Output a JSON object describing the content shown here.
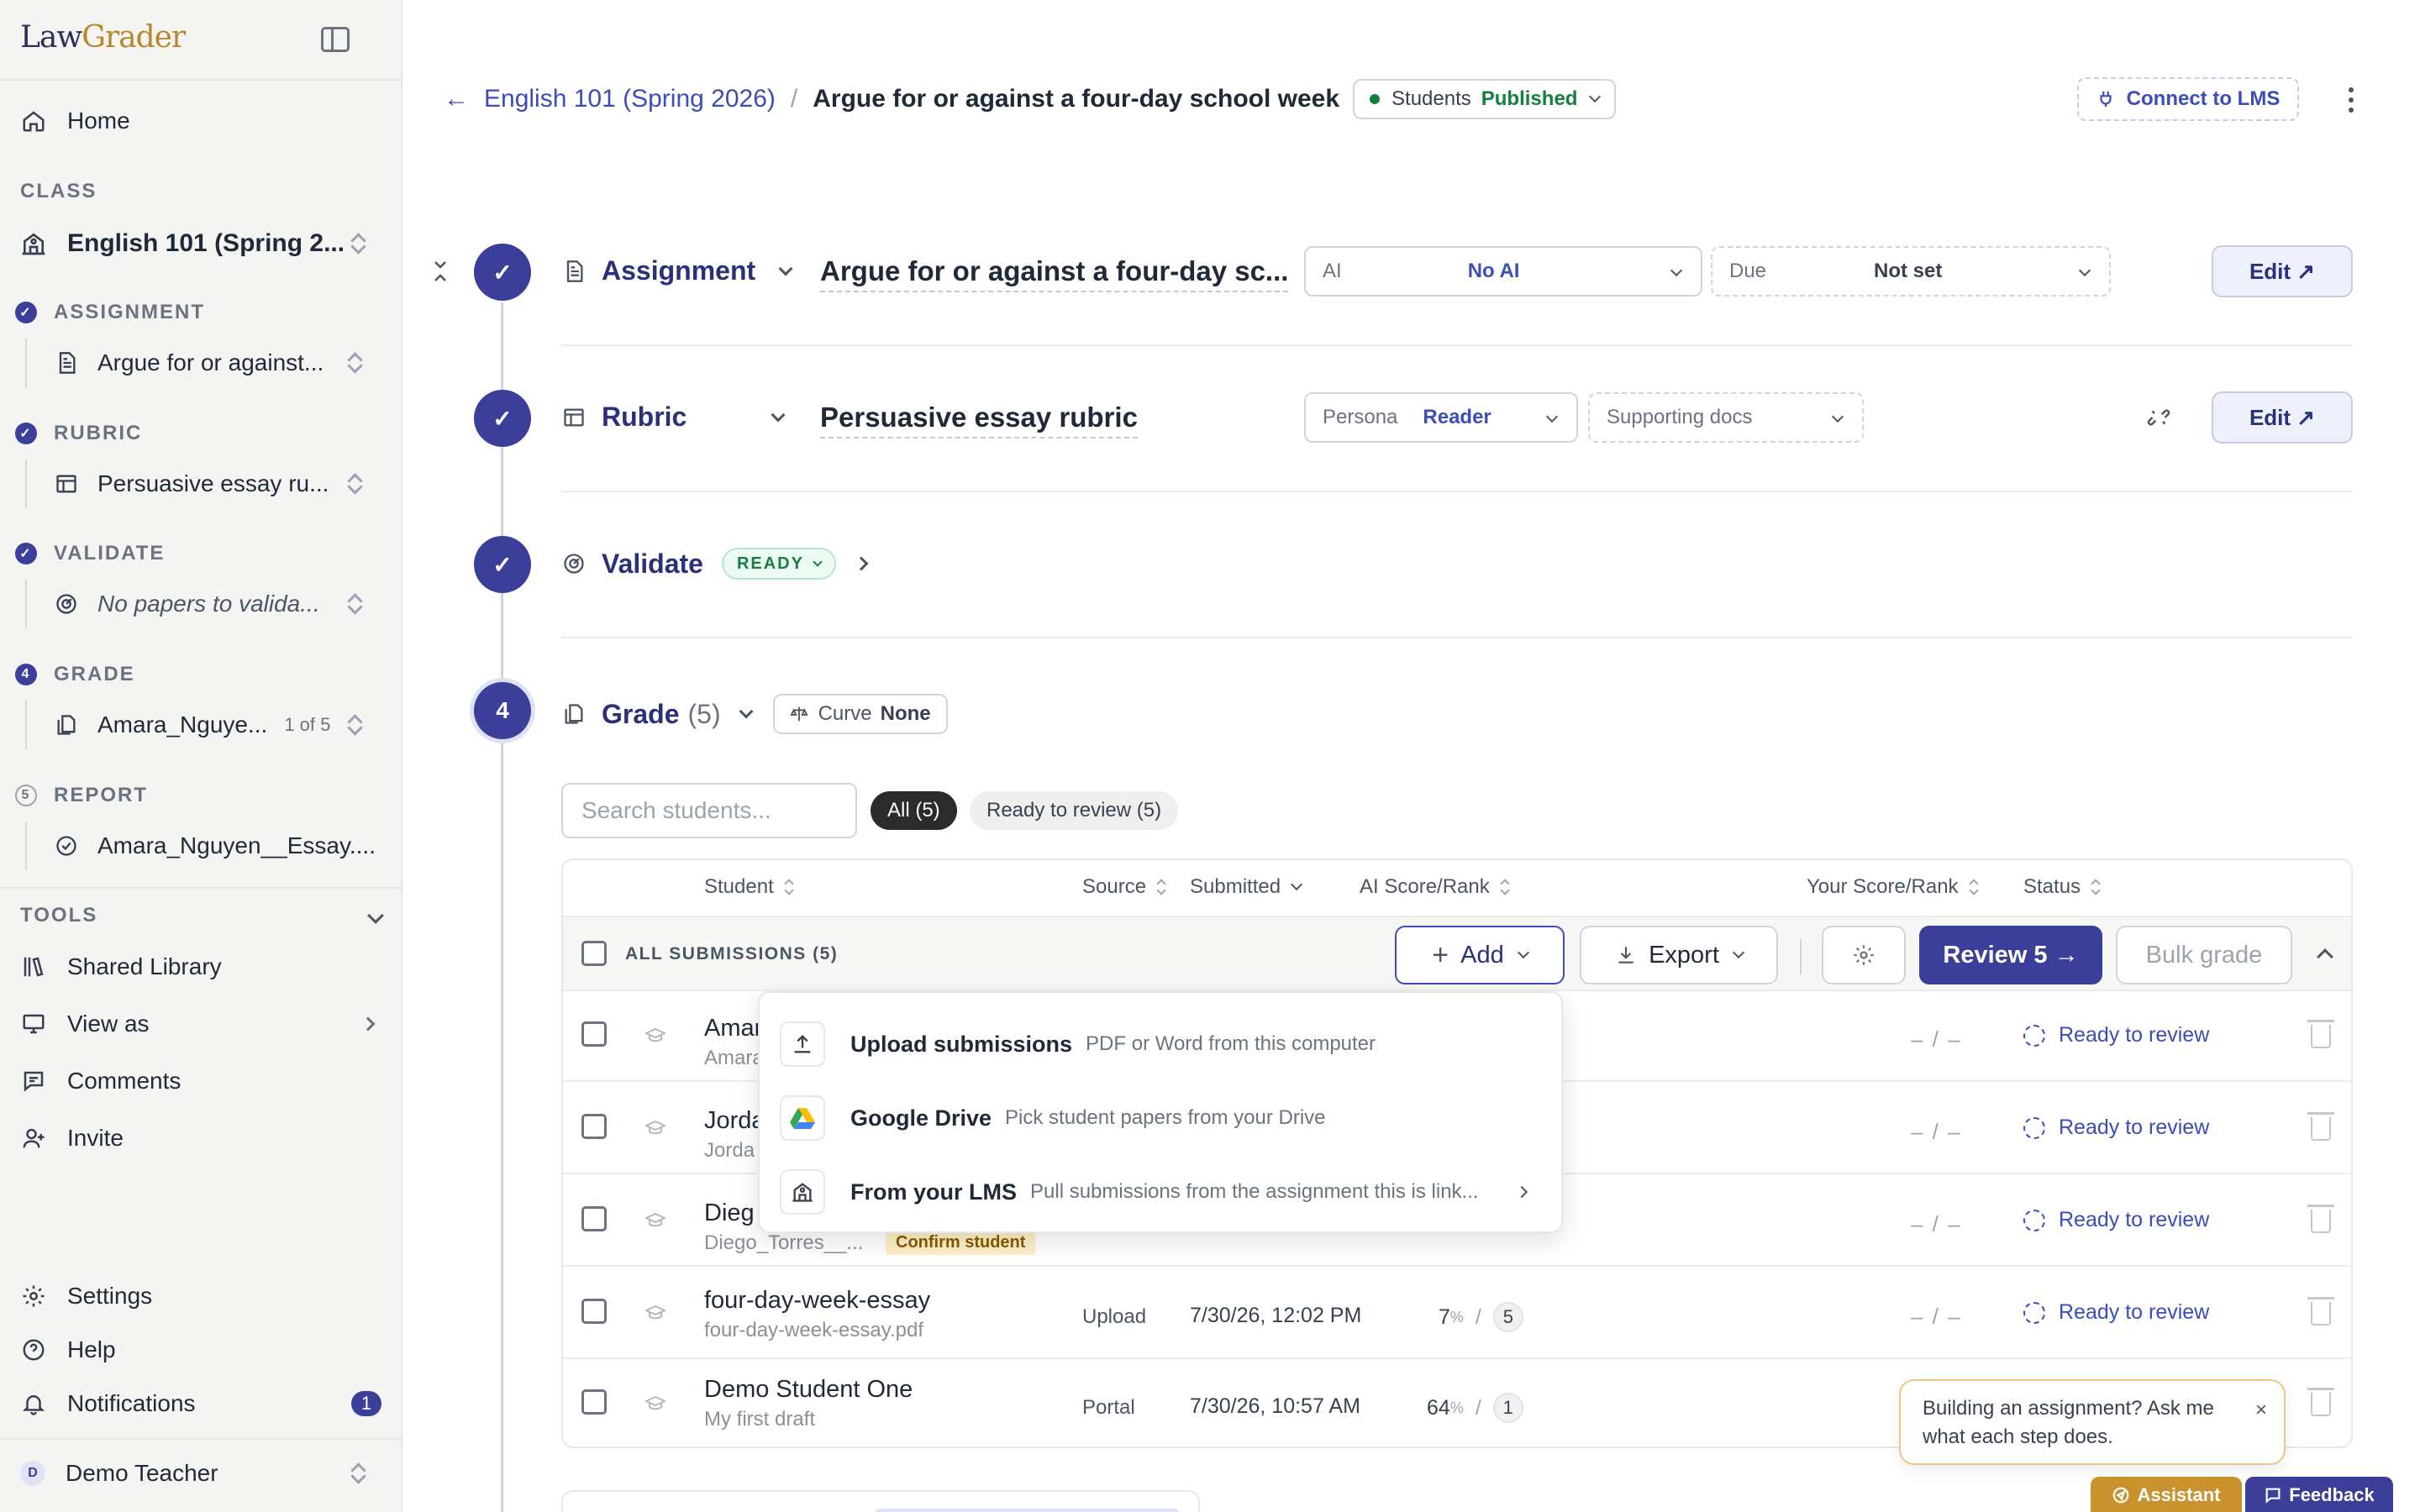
{
  "app": {
    "logo_law": "Law",
    "logo_grader": "Grader"
  },
  "sidebar": {
    "home": "Home",
    "class_label": "CLASS",
    "class_name": "English 101 (Spring 2...",
    "steps": [
      {
        "label": "ASSIGNMENT",
        "marker": "✓",
        "item": "Argue for or against..."
      },
      {
        "label": "RUBRIC",
        "marker": "✓",
        "item": "Persuasive essay ru..."
      },
      {
        "label": "VALIDATE",
        "marker": "✓",
        "item": "No papers to valida..."
      },
      {
        "label": "GRADE",
        "marker": "4",
        "item": "Amara_Nguye...",
        "meta": "1 of 5"
      },
      {
        "label": "REPORT",
        "marker": "5",
        "item": "Amara_Nguyen__Essay...."
      }
    ],
    "tools_label": "TOOLS",
    "tools": [
      "Shared Library",
      "View as",
      "Comments",
      "Invite"
    ],
    "settings": "Settings",
    "help": "Help",
    "notifications": "Notifications",
    "notifications_count": "1",
    "user_initial": "D",
    "user_name": "Demo Teacher"
  },
  "header": {
    "back_arrow": "←",
    "class_link": "English 101 (Spring 2026)",
    "separator": "/",
    "assignment_title": "Argue for or against a four-day school week",
    "visibility_label": "Students",
    "visibility_status": "Published",
    "connect_lms": "Connect to LMS"
  },
  "steps": {
    "assignment": {
      "marker": "✓",
      "label": "Assignment",
      "title": "Argue for or against a four-day sc...",
      "ai_key": "AI",
      "ai_value": "No AI",
      "due_key": "Due",
      "due_value": "Not set",
      "edit": "Edit ↗"
    },
    "rubric": {
      "marker": "✓",
      "label": "Rubric",
      "title": "Persuasive essay rubric",
      "persona_key": "Persona",
      "persona_value": "Reader",
      "supporting_docs": "Supporting docs",
      "edit": "Edit ↗"
    },
    "validate": {
      "marker": "✓",
      "label": "Validate",
      "badge": "READY"
    },
    "grade": {
      "marker": "4",
      "label": "Grade",
      "count": "(5)",
      "curve_key": "Curve",
      "curve_value": "None"
    }
  },
  "grade": {
    "search_placeholder": "Search students...",
    "filter_all": "All (5)",
    "filter_ready": "Ready to review (5)",
    "columns": {
      "student": "Student",
      "source": "Source",
      "submitted": "Submitted",
      "ai_score": "AI Score/Rank",
      "your_score": "Your Score/Rank",
      "status": "Status"
    },
    "toolbar": {
      "all_submissions": "ALL SUBMISSIONS (5)",
      "add": "Add",
      "export": "Export",
      "review": "Review 5 →",
      "bulk_grade": "Bulk grade"
    },
    "rows": [
      {
        "name": "Amar",
        "file": "Amara",
        "source": "",
        "submitted": "",
        "ai_pct": "",
        "ai_rank": "",
        "your_score": "– / –",
        "status": "Ready to review"
      },
      {
        "name": "Jorda",
        "file": "Jorda",
        "source": "",
        "submitted": "",
        "ai_pct": "",
        "ai_rank": "",
        "your_score": "– / –",
        "status": "Ready to review"
      },
      {
        "name": "Dieg",
        "file": "Diego_Torres__...",
        "confirm": "Confirm student",
        "source": "",
        "submitted": "",
        "ai_pct": "",
        "ai_rank": "",
        "your_score": "– / –",
        "status": "Ready to review"
      },
      {
        "name": "four-day-week-essay",
        "file": "four-day-week-essay.pdf",
        "source": "Upload",
        "submitted": "7/30/26, 12:02 PM",
        "ai_pct": "7",
        "pct_sign": "%",
        "ai_rank": "5",
        "your_score": "– / –",
        "status": "Ready to review"
      },
      {
        "name": "Demo Student One",
        "file": "My first draft",
        "source": "Portal",
        "submitted": "7/30/26, 10:57 AM",
        "ai_pct": "64",
        "pct_sign": "%",
        "ai_rank": "1",
        "your_score": "",
        "status": ""
      }
    ]
  },
  "add_menu": {
    "items": [
      {
        "title": "Upload submissions",
        "desc": "PDF or Word from this computer",
        "icon": "upload-icon"
      },
      {
        "title": "Google Drive",
        "desc": "Pick student papers from your Drive",
        "icon": "google-drive-icon"
      },
      {
        "title": "From your LMS",
        "desc": "Pull submissions from the assignment this is link...",
        "icon": "lms-building-icon"
      }
    ]
  },
  "assistant": {
    "tip": "Building an assignment? Ask me what each step does.",
    "close": "×",
    "assistant_button": "Assistant",
    "feedback_button": "Feedback"
  },
  "colors": {
    "brand": "#3b3f9a",
    "link": "#3b4db8",
    "accent": "#c9922c",
    "success": "#15803d"
  }
}
